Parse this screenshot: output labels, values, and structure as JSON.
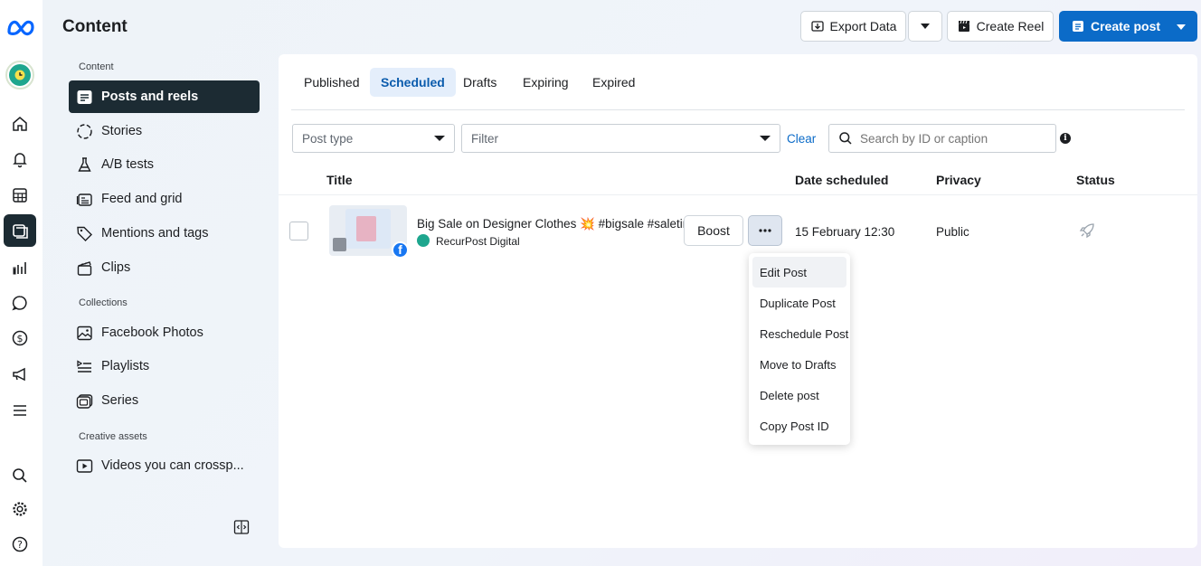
{
  "header": {
    "title": "Content",
    "export_label": "Export Data",
    "create_reel_label": "Create Reel",
    "create_post_label": "Create post"
  },
  "sidebar": {
    "sections": [
      {
        "label": "Content"
      },
      {
        "label": "Collections"
      },
      {
        "label": "Creative assets"
      }
    ],
    "items": [
      {
        "label": "Posts and reels",
        "icon": "posts-icon",
        "active": true
      },
      {
        "label": "Stories",
        "icon": "stories-icon"
      },
      {
        "label": "A/B tests",
        "icon": "flask-icon"
      },
      {
        "label": "Feed and grid",
        "icon": "feed-icon"
      },
      {
        "label": "Mentions and tags",
        "icon": "tag-icon"
      },
      {
        "label": "Clips",
        "icon": "clapper-icon"
      },
      {
        "label": "Facebook Photos",
        "icon": "photo-icon"
      },
      {
        "label": "Playlists",
        "icon": "playlist-icon"
      },
      {
        "label": "Series",
        "icon": "series-icon"
      },
      {
        "label": "Videos you can crossp...",
        "icon": "video-icon"
      }
    ]
  },
  "tabs": [
    {
      "label": "Published"
    },
    {
      "label": "Scheduled",
      "active": true
    },
    {
      "label": "Drafts"
    },
    {
      "label": "Expiring"
    },
    {
      "label": "Expired"
    }
  ],
  "filters": {
    "post_type": "Post type",
    "filter": "Filter",
    "clear": "Clear",
    "search_placeholder": "Search by ID or caption"
  },
  "table": {
    "columns": [
      "Title",
      "Date scheduled",
      "Privacy",
      "Status"
    ],
    "rows": [
      {
        "title": "Big Sale on Designer Clothes 💥 #bigsale #saletime",
        "page": "RecurPost Digital",
        "boost": "Boost",
        "date": "15 February 12:30",
        "privacy": "Public"
      }
    ]
  },
  "menu": {
    "items": [
      "Edit Post",
      "Duplicate Post",
      "Reschedule Post",
      "Move to Drafts",
      "Delete post",
      "Copy Post ID"
    ]
  },
  "colors": {
    "accent": "#0b6bc8",
    "active_nav": "#1c2b33",
    "active_tab_bg": "#e4eefb",
    "brand_green": "#1ea68e"
  }
}
